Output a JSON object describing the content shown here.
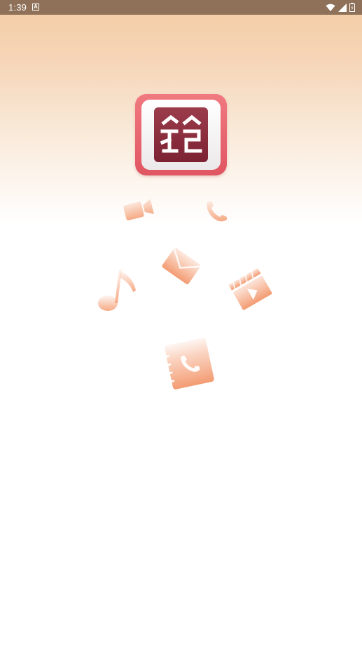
{
  "status_bar": {
    "time": "1:39",
    "notification_icon": "a-box-icon",
    "wifi_icon": "wifi-icon",
    "signal_icon": "signal-icon",
    "battery_icon": "battery-icon"
  },
  "splash": {
    "app_icon": "app-logo-icon",
    "floating_icons": [
      "video-camera-icon",
      "phone-handset-icon",
      "envelope-icon",
      "music-note-icon",
      "clapperboard-play-icon",
      "contact-book-phone-icon"
    ],
    "accent_color": "#f5a57e",
    "logo_red": "#e05561",
    "logo_dark": "#7c2233",
    "status_bar_color": "#8e7158"
  }
}
